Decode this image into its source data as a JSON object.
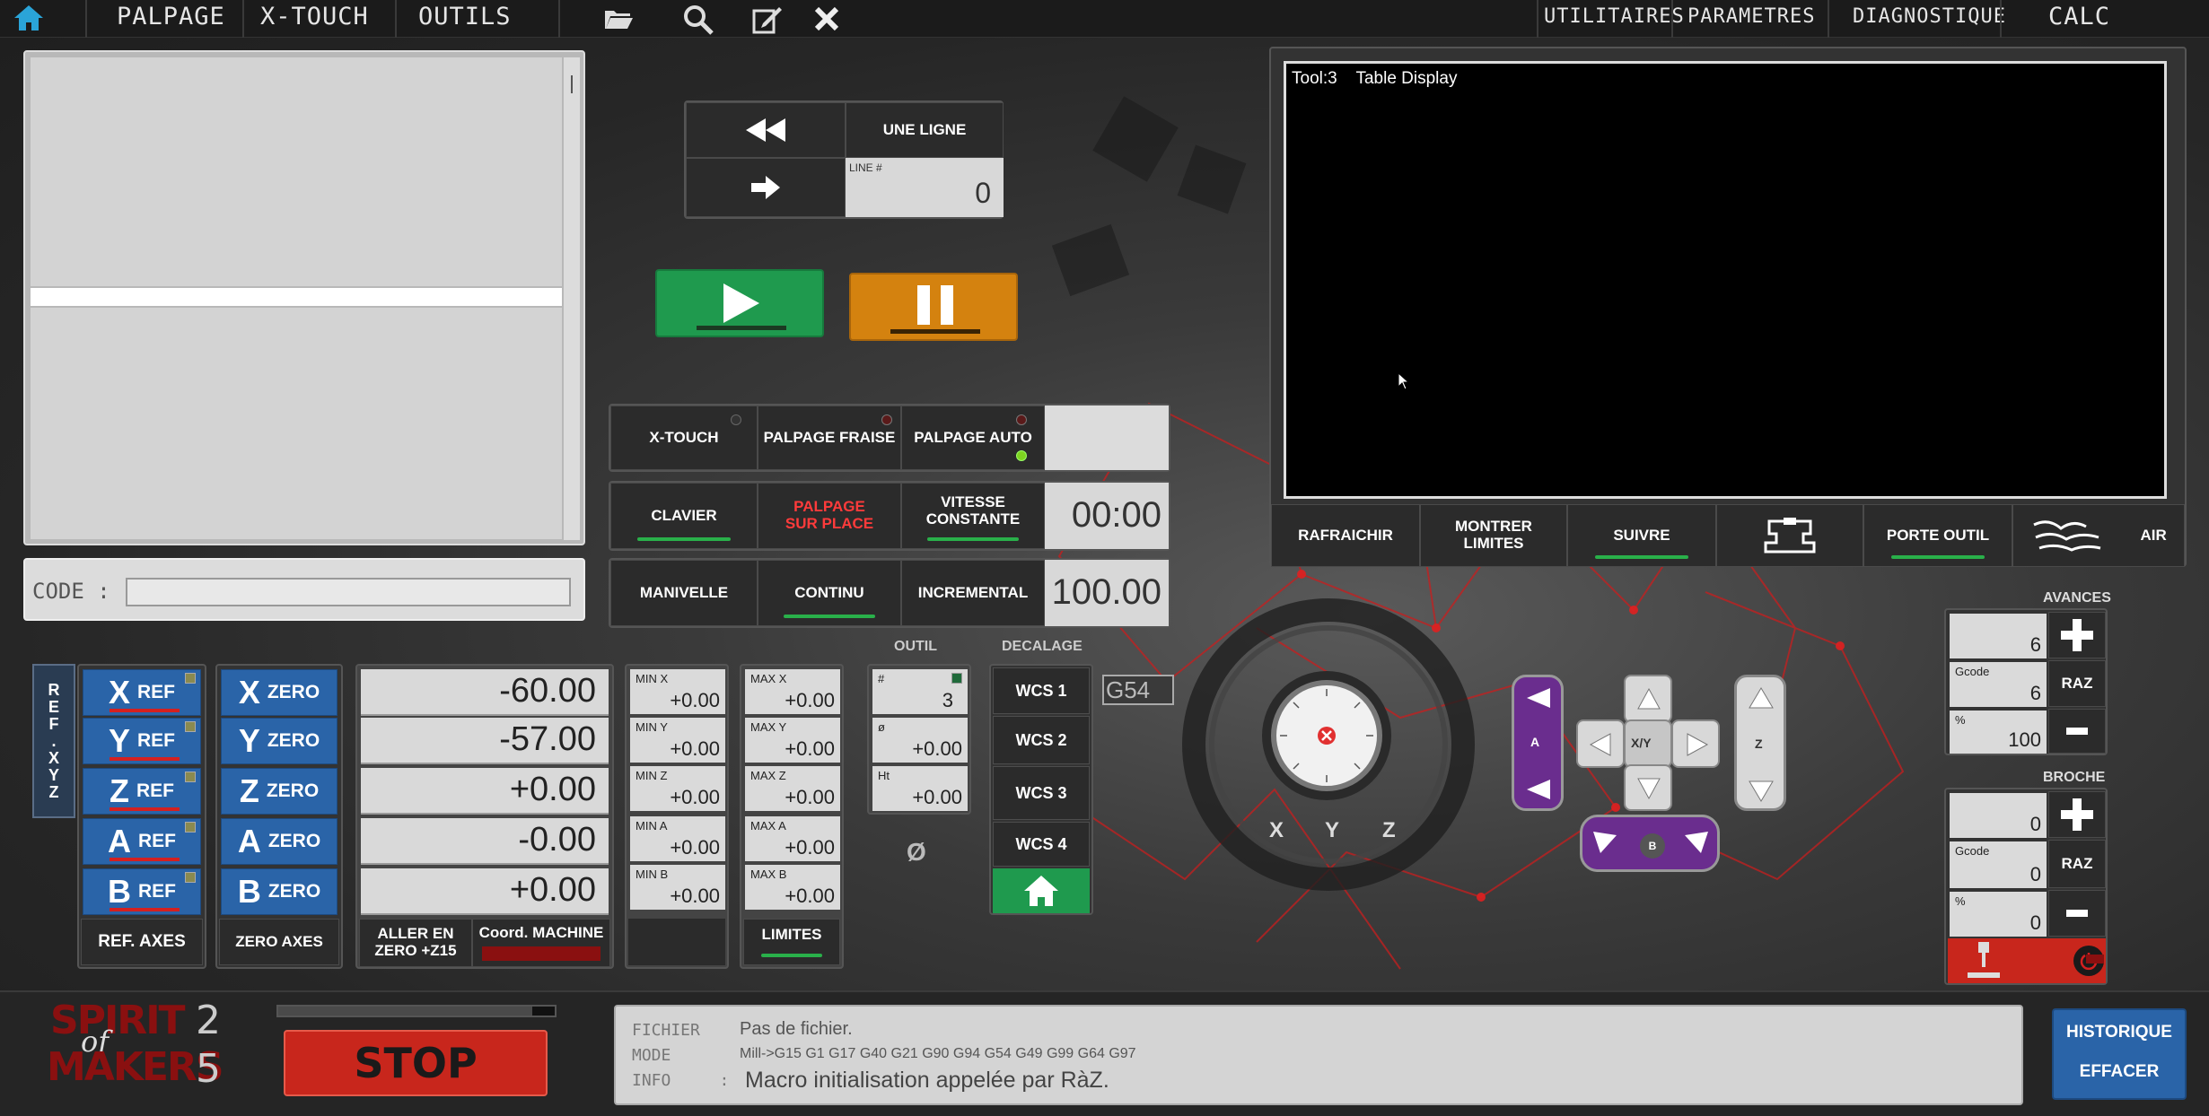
{
  "topbar": {
    "palpage": "PALPAGE",
    "xtouch": "X-TOUCH",
    "outils": "OUTILS",
    "utilitaires": "UTILITAIRES",
    "parametres": "PARAMETRES",
    "diagnostique": "DIAGNOSTIQUE",
    "calc": "CALC"
  },
  "code": {
    "label": "CODE :",
    "value": ""
  },
  "line_ctrl": {
    "une_ligne": "UNE LIGNE",
    "line_label": "LINE #",
    "line_value": "0"
  },
  "probe": {
    "xtouch": "X-TOUCH",
    "palpage_fraise": "PALPAGE FRAISE",
    "palpage_auto": "PALPAGE AUTO"
  },
  "modes": {
    "clavier": "CLAVIER",
    "palpage_sur_place_1": "PALPAGE",
    "palpage_sur_place_2": "SUR PLACE",
    "vitesse_1": "VITESSE",
    "vitesse_2": "CONSTANTE",
    "time": "00:00",
    "manivelle": "MANIVELLE",
    "continu": "CONTINU",
    "incremental": "INCREMENTAL",
    "jog_rate": "100.00"
  },
  "toolpath": {
    "title": "Tool:3    Table Display",
    "rafraichir": "RAFRAICHIR",
    "montrer_1": "MONTRER",
    "montrer_2": "LIMITES",
    "suivre": "SUIVRE",
    "porte_outil": "PORTE OUTIL",
    "air": "AIR"
  },
  "axes": {
    "ref_side": [
      "R",
      "E",
      "F",
      ".",
      "X",
      "Y",
      "Z"
    ],
    "rows": [
      {
        "letter": "X",
        "ref": "REF",
        "zero": "ZERO",
        "dro": "-60.00",
        "min_lbl": "MIN X",
        "min": "+0.00",
        "max_lbl": "MAX X",
        "max": "+0.00"
      },
      {
        "letter": "Y",
        "ref": "REF",
        "zero": "ZERO",
        "dro": "-57.00",
        "min_lbl": "MIN Y",
        "min": "+0.00",
        "max_lbl": "MAX Y",
        "max": "+0.00"
      },
      {
        "letter": "Z",
        "ref": "REF",
        "zero": "ZERO",
        "dro": "+0.00",
        "min_lbl": "MIN Z",
        "min": "+0.00",
        "max_lbl": "MAX Z",
        "max": "+0.00"
      },
      {
        "letter": "A",
        "ref": "REF",
        "zero": "ZERO",
        "dro": "-0.00",
        "min_lbl": "MIN A",
        "min": "+0.00",
        "max_lbl": "MAX  A",
        "max": "+0.00"
      },
      {
        "letter": "B",
        "ref": "REF",
        "zero": "ZERO",
        "dro": "+0.00",
        "min_lbl": "MIN B",
        "min": "+0.00",
        "max_lbl": "MAX  B",
        "max": "+0.00"
      }
    ],
    "ref_axes": "REF. AXES",
    "zero_axes": "ZERO AXES",
    "aller_1": "ALLER EN",
    "aller_2": "ZERO +Z15",
    "coord_machine": "Coord. MACHINE",
    "limites": "LIMITES"
  },
  "outil": {
    "title": "OUTIL",
    "num_lbl": "#",
    "num": "3",
    "dia_lbl": "ø",
    "dia": "+0.00",
    "ht_lbl": "Ht",
    "ht": "+0.00",
    "symbol": "Ø"
  },
  "decalage": {
    "title": "DECALAGE",
    "wcs1": "WCS 1",
    "wcs2": "WCS 2",
    "wcs3": "WCS 3",
    "wcs4": "WCS 4",
    "current": "G54"
  },
  "mpg": {
    "x": "X",
    "y": "Y",
    "z": "Z"
  },
  "jog": {
    "a": "A",
    "xy": "X/Y",
    "z": "Z",
    "b": "B"
  },
  "avances": {
    "title": "AVANCES",
    "val1": "6",
    "gcode_lbl": "Gcode",
    "gcode": "6",
    "pct_lbl": "%",
    "pct": "100",
    "raz": "RAZ"
  },
  "broche": {
    "title": "BROCHE",
    "val1": "0",
    "gcode_lbl": "Gcode",
    "gcode": "0",
    "pct_lbl": "%",
    "pct": "0",
    "raz": "RAZ"
  },
  "footer": {
    "logo_1": "SPIRIT",
    "logo_of": "of",
    "logo_2": "MAKERS",
    "logo_n1": "2",
    "logo_n2": "5",
    "stop": "STOP",
    "fichier_lbl": "FICHIER",
    "fichier": "Pas de fichier.",
    "mode_lbl": "MODE",
    "mode": "Mill->G15  G1 G17 G40 G21 G90 G94 G54 G49 G99 G64 G97",
    "info_lbl": "INFO     :",
    "info": "Macro initialisation appelée par RàZ.",
    "historique": "HISTORIQUE",
    "effacer": "EFFACER"
  },
  "colors": {
    "accent_blue": "#2a64a8",
    "run_green": "#1f9a4e",
    "pause_orange": "#d4820f",
    "stop_red": "#c8261c",
    "jog_purple": "#6a2d8e"
  }
}
